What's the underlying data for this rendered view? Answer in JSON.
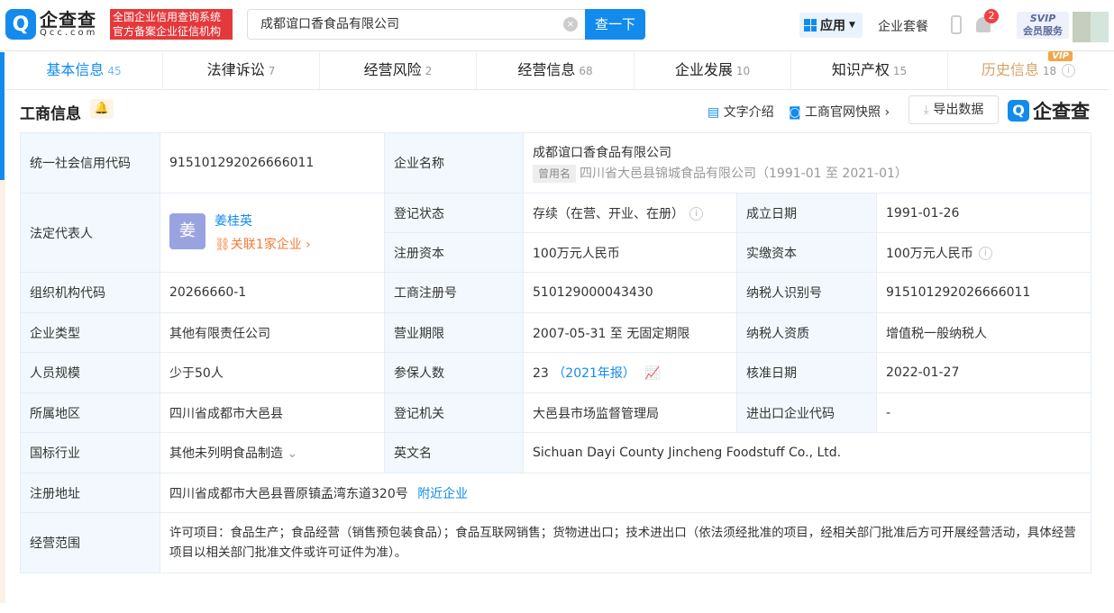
{
  "header": {
    "logo_cn": "企查查",
    "logo_en": "Qcc.com",
    "slogan": [
      "全国企业信用查询系统",
      "官方备案企业征信机构"
    ],
    "search_value": "成都谊口香食品有限公司",
    "search_button": "查一下",
    "app_label": "应用",
    "package_label": "企业套餐",
    "notification_count": "2",
    "svip_top": "SVIP",
    "svip_bottom": "会员服务"
  },
  "tabs": [
    {
      "label": "基本信息",
      "count": "45"
    },
    {
      "label": "法律诉讼",
      "count": "7"
    },
    {
      "label": "经营风险",
      "count": "2"
    },
    {
      "label": "经营信息",
      "count": "68"
    },
    {
      "label": "企业发展",
      "count": "10"
    },
    {
      "label": "知识产权",
      "count": "15"
    },
    {
      "label": "历史信息",
      "count": "18",
      "badge": "VIP"
    }
  ],
  "section": {
    "title": "工商信息",
    "text_intro": "文字介绍",
    "snapshot": "工商官网快照",
    "export": "导出数据",
    "brand": "企查查"
  },
  "info": {
    "credit_code_label": "统一社会信用代码",
    "credit_code": "915101292026666011",
    "name_label": "企业名称",
    "name": "成都谊口香食品有限公司",
    "former_tag": "曾用名",
    "former_name": "四川省大邑县锦城食品有限公司（1991-01 至 2021-01）",
    "legal_label": "法定代表人",
    "legal_avatar": "姜",
    "legal_name": "姜桂英",
    "legal_related": "关联1家企业",
    "status_label": "登记状态",
    "status": "存续（在营、开业、在册）",
    "found_label": "成立日期",
    "found": "1991-01-26",
    "reg_cap_label": "注册资本",
    "reg_cap": "100万元人民币",
    "paid_cap_label": "实缴资本",
    "paid_cap": "100万元人民币",
    "org_code_label": "组织机构代码",
    "org_code": "20266660-1",
    "reg_no_label": "工商注册号",
    "reg_no": "510129000043430",
    "tax_id_label": "纳税人识别号",
    "tax_id": "915101292026666011",
    "type_label": "企业类型",
    "type": "其他有限责任公司",
    "term_label": "营业期限",
    "term": "2007-05-31 至 无固定期限",
    "tax_qual_label": "纳税人资质",
    "tax_qual": "增值税一般纳税人",
    "staff_label": "人员规模",
    "staff": "少于50人",
    "insured_label": "参保人数",
    "insured": "23",
    "insured_year": "（2021年报）",
    "approve_label": "核准日期",
    "approve": "2022-01-27",
    "region_label": "所属地区",
    "region": "四川省成都市大邑县",
    "authority_label": "登记机关",
    "authority": "大邑县市场监督管理局",
    "ie_label": "进出口企业代码",
    "ie": "-",
    "industry_label": "国标行业",
    "industry": "其他未列明食品制造",
    "en_label": "英文名",
    "en": "Sichuan Dayi County Jincheng Foodstuff Co., Ltd.",
    "addr_label": "注册地址",
    "addr": "四川省成都市大邑县晋原镇孟湾东道320号",
    "nearby": "附近企业",
    "scope_label": "经营范围",
    "scope": "许可项目：食品生产；食品经营（销售预包装食品）；食品互联网销售；货物进出口；技术进出口（依法须经批准的项目，经相关部门批准后方可开展经营活动，具体经营项目以相关部门批准文件或许可证件为准）。"
  }
}
